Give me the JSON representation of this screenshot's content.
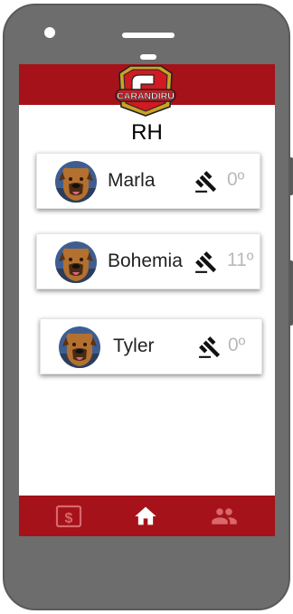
{
  "app": {
    "logo_text": "CARANDIRU"
  },
  "page": {
    "title": "RH"
  },
  "employees": [
    {
      "name": "Marla",
      "count": "0º"
    },
    {
      "name": "Bohemia",
      "count": "11º"
    },
    {
      "name": "Tyler",
      "count": "0º"
    }
  ],
  "nav": {
    "items": [
      {
        "icon": "dollar-icon",
        "active": false
      },
      {
        "icon": "home-icon",
        "active": true
      },
      {
        "icon": "people-icon",
        "active": false
      }
    ]
  },
  "colors": {
    "brand": "#a51219",
    "nav_inactive": "#d9676c",
    "nav_active": "#ffffff",
    "count_text": "#b9b9b9"
  }
}
